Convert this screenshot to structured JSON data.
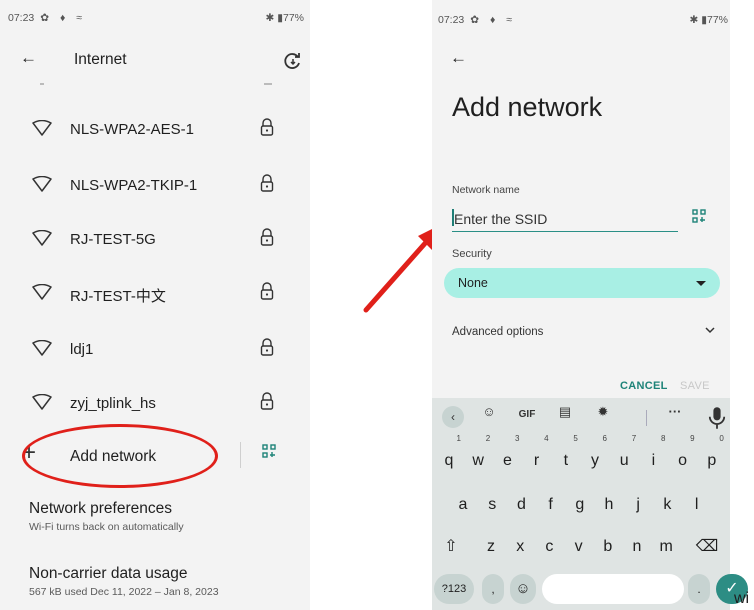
{
  "left_phone": {
    "status_bar": {
      "time": "07:23",
      "icons_left": "✿ ♦ ≈",
      "battery": "77%"
    },
    "header": {
      "title": "Internet"
    },
    "networks": [
      {
        "ssid": "NLS-WPA2-AES-1",
        "secured": true
      },
      {
        "ssid": "NLS-WPA2-TKIP-1",
        "secured": true
      },
      {
        "ssid": "RJ-TEST-5G",
        "secured": true
      },
      {
        "ssid": "RJ-TEST-中文",
        "secured": true
      },
      {
        "ssid": "ldj1",
        "secured": true
      },
      {
        "ssid": "zyj_tplink_hs",
        "secured": true
      }
    ],
    "add_network": {
      "label": "Add network",
      "highlight_color": "#e0201a"
    },
    "network_preferences": {
      "title": "Network preferences",
      "subtitle": "Wi-Fi turns back on automatically"
    },
    "data_usage": {
      "title": "Non-carrier data usage",
      "subtitle": "567 kB used Dec 11, 2022 – Jan 8, 2023"
    }
  },
  "arrow_color": "#e0201a",
  "right_phone": {
    "status_bar": {
      "time": "07:23",
      "icons_left": "✿ ♦ ≈",
      "battery": "77%"
    },
    "title": "Add network",
    "network_name": {
      "label": "Network name",
      "placeholder": "Enter the SSID"
    },
    "security": {
      "label": "Security",
      "value": "None"
    },
    "advanced_options": "Advanced options",
    "actions": {
      "cancel": "CANCEL",
      "save": "SAVE"
    },
    "keyboard": {
      "toolbar": {
        "gif": "GIF",
        "more": "···"
      },
      "row1": [
        {
          "k": "q",
          "n": "1"
        },
        {
          "k": "w",
          "n": "2"
        },
        {
          "k": "e",
          "n": "3"
        },
        {
          "k": "r",
          "n": "4"
        },
        {
          "k": "t",
          "n": "5"
        },
        {
          "k": "y",
          "n": "6"
        },
        {
          "k": "u",
          "n": "7"
        },
        {
          "k": "i",
          "n": "8"
        },
        {
          "k": "o",
          "n": "9"
        },
        {
          "k": "p",
          "n": "0"
        }
      ],
      "row2": [
        "a",
        "s",
        "d",
        "f",
        "g",
        "h",
        "j",
        "k",
        "l"
      ],
      "row3": [
        "z",
        "x",
        "c",
        "v",
        "b",
        "n",
        "m"
      ],
      "sym_key": "?123",
      "comma": ",",
      "period": ".",
      "accent_color": "#2d8d84"
    }
  },
  "trailing_text": "wi"
}
